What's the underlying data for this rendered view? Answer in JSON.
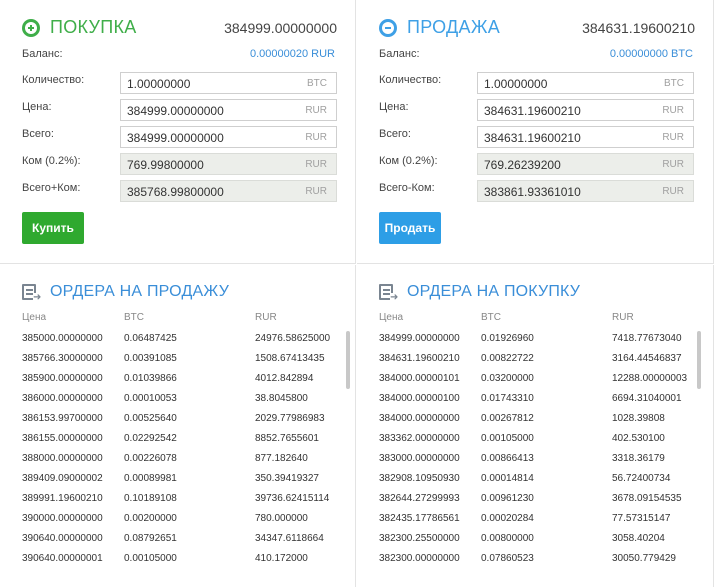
{
  "buy": {
    "title": "ПОКУПКА",
    "price": "384999.00000000",
    "balance_label": "Баланс:",
    "balance_value": "0.00000020 RUR",
    "fields": [
      {
        "label": "Количество:",
        "value": "1.00000000",
        "currency": "BTC",
        "readonly": false
      },
      {
        "label": "Цена:",
        "value": "384999.00000000",
        "currency": "RUR",
        "readonly": false
      },
      {
        "label": "Всего:",
        "value": "384999.00000000",
        "currency": "RUR",
        "readonly": false
      },
      {
        "label": "Ком (0.2%):",
        "value": "769.99800000",
        "currency": "RUR",
        "readonly": true
      },
      {
        "label": "Всего+Ком:",
        "value": "385768.99800000",
        "currency": "RUR",
        "readonly": true
      }
    ],
    "button": "Купить",
    "accent": "#3fae49"
  },
  "sell": {
    "title": "ПРОДАЖА",
    "price": "384631.19600210",
    "balance_label": "Баланс:",
    "balance_value": "0.00000000 BTC",
    "fields": [
      {
        "label": "Количество:",
        "value": "1.00000000",
        "currency": "BTC",
        "readonly": false
      },
      {
        "label": "Цена:",
        "value": "384631.19600210",
        "currency": "RUR",
        "readonly": false
      },
      {
        "label": "Всего:",
        "value": "384631.19600210",
        "currency": "RUR",
        "readonly": false
      },
      {
        "label": "Ком (0.2%):",
        "value": "769.26239200",
        "currency": "RUR",
        "readonly": true
      },
      {
        "label": "Всего-Ком:",
        "value": "383861.93361010",
        "currency": "RUR",
        "readonly": true
      }
    ],
    "button": "Продать",
    "accent": "#3ea0e6"
  },
  "sell_orders": {
    "title": "ОРДЕРА НА ПРОДАЖУ",
    "columns": [
      "Цена",
      "BTC",
      "RUR"
    ],
    "rows": [
      [
        "385000.00000000",
        "0.06487425",
        "24976.58625000"
      ],
      [
        "385766.30000000",
        "0.00391085",
        "1508.67413435"
      ],
      [
        "385900.00000000",
        "0.01039866",
        "4012.842894"
      ],
      [
        "386000.00000000",
        "0.00010053",
        "38.8045800"
      ],
      [
        "386153.99700000",
        "0.00525640",
        "2029.77986983"
      ],
      [
        "386155.00000000",
        "0.02292542",
        "8852.7655601"
      ],
      [
        "388000.00000000",
        "0.00226078",
        "877.182640"
      ],
      [
        "389409.09000002",
        "0.00089981",
        "350.39419327"
      ],
      [
        "389991.19600210",
        "0.10189108",
        "39736.62415114"
      ],
      [
        "390000.00000000",
        "0.00200000",
        "780.000000"
      ],
      [
        "390640.00000000",
        "0.08792651",
        "34347.6118664"
      ],
      [
        "390640.00000001",
        "0.00105000",
        "410.172000"
      ]
    ]
  },
  "buy_orders": {
    "title": "ОРДЕРА НА ПОКУПКУ",
    "columns": [
      "Цена",
      "BTC",
      "RUR"
    ],
    "rows": [
      [
        "384999.00000000",
        "0.01926960",
        "7418.77673040"
      ],
      [
        "384631.19600210",
        "0.00822722",
        "3164.44546837"
      ],
      [
        "384000.00000101",
        "0.03200000",
        "12288.00000003"
      ],
      [
        "384000.00000100",
        "0.01743310",
        "6694.31040001"
      ],
      [
        "384000.00000000",
        "0.00267812",
        "1028.39808"
      ],
      [
        "383362.00000000",
        "0.00105000",
        "402.530100"
      ],
      [
        "383000.00000000",
        "0.00866413",
        "3318.36179"
      ],
      [
        "382908.10950930",
        "0.00014814",
        "56.72400734"
      ],
      [
        "382644.27299993",
        "0.00961230",
        "3678.09154535"
      ],
      [
        "382435.17786561",
        "0.00020284",
        "77.57315147"
      ],
      [
        "382300.25500000",
        "0.00800000",
        "3058.40204"
      ],
      [
        "382300.00000000",
        "0.07860523",
        "30050.779429"
      ]
    ]
  }
}
